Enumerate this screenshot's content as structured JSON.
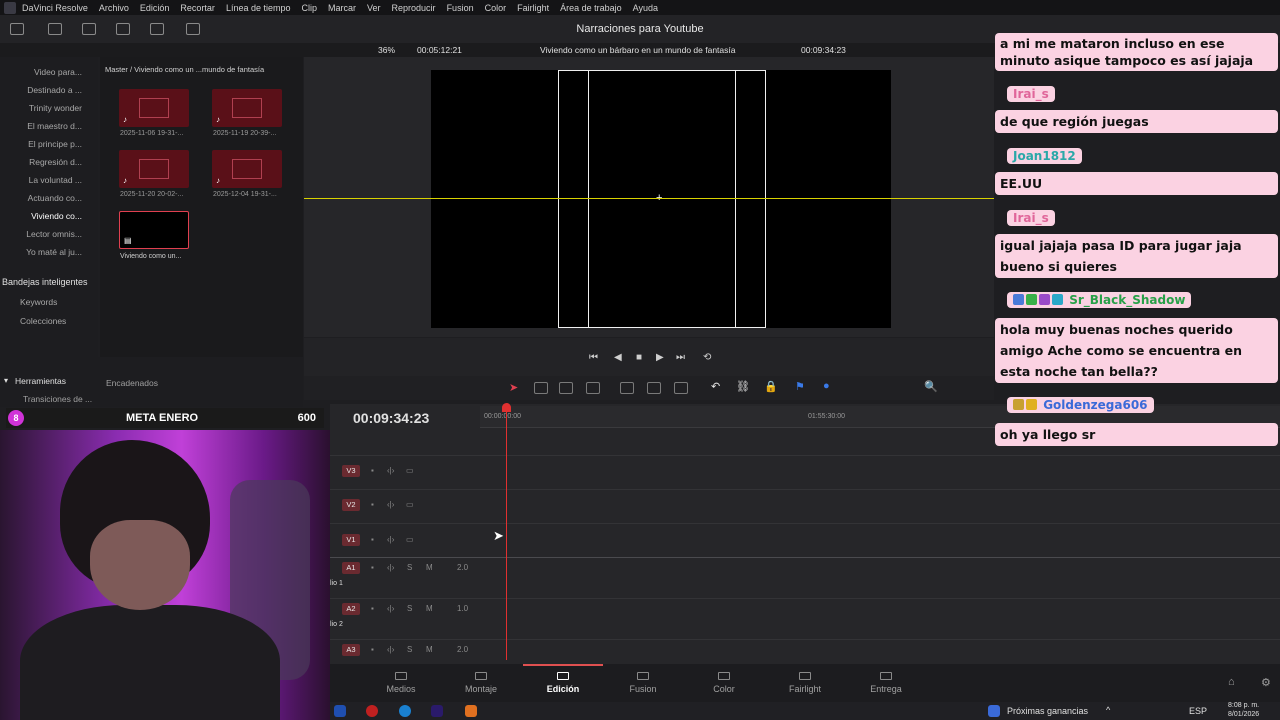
{
  "menubar": {
    "items": [
      "DaVinci Resolve",
      "Archivo",
      "Edición",
      "Recortar",
      "Línea de tiempo",
      "Clip",
      "Marcar",
      "Ver",
      "Reproducir",
      "Fusion",
      "Color",
      "Fairlight",
      "Área de trabajo",
      "Ayuda"
    ]
  },
  "titlebar": {
    "title": "Narraciones para Youtube"
  },
  "viewer_bar": {
    "zoom": "36%",
    "source_timecode": "00:05:12:21",
    "timeline_name": "Viviendo como un bárbaro en un mundo de fantasía",
    "record_timecode": "00:09:34:23"
  },
  "bins": {
    "items": [
      "Video para...",
      "Destinado a ...",
      "Trinity wonder",
      "El maestro d...",
      "El principe p...",
      "Regresión d...",
      "La voluntad ...",
      "Actuando co...",
      "Viviendo co...",
      "Lector omnis...",
      "Yo maté al ju..."
    ],
    "active_index": 8,
    "smart_bins_title": "Bandejas inteligentes",
    "smart_bins": [
      "Keywords",
      "Colecciones"
    ]
  },
  "media_pool": {
    "path": "Master / Viviendo como un ...mundo de fantasía",
    "clips": [
      {
        "name": "2025-11-06 19-31-..."
      },
      {
        "name": "2025-11-19 20-39-..."
      },
      {
        "name": "2025-11-20 20-02-..."
      },
      {
        "name": "2025-12-04 19-31-..."
      },
      {
        "name": "Viviendo como un..."
      }
    ]
  },
  "lower_left": {
    "tools_label": "Herramientas",
    "transitions": "Transiciones de ...",
    "transitions2": "Transiciones de ...",
    "chained_label": "Encadenados"
  },
  "timeline": {
    "timecode": "00:09:34:23",
    "ruler_start": "00:00:00:00",
    "ruler_mid": "01:55:30:00",
    "tracks": [
      {
        "label": "V3"
      },
      {
        "label": "V2"
      },
      {
        "label": "V1"
      },
      {
        "label": "A1",
        "level": "2.0",
        "name": "lio 1"
      },
      {
        "label": "A2",
        "level": "1.0",
        "name": "lio 2"
      },
      {
        "label": "A3",
        "level": "2.0"
      }
    ]
  },
  "stream_overlay": {
    "badge": "8",
    "goal_label": "META ENERO",
    "goal_count": "600"
  },
  "chat": [
    {
      "type": "msg",
      "text": "a mi me mataron incluso en ese minuto asique tampoco es así jajaja"
    },
    {
      "type": "user",
      "name": "Irai_s",
      "color": "pink"
    },
    {
      "type": "msg",
      "text": "de que región juegas"
    },
    {
      "type": "user",
      "name": "Joan1812",
      "color": "teal"
    },
    {
      "type": "msg",
      "text": "EE.UU"
    },
    {
      "type": "user",
      "name": "Irai_s",
      "color": "pink"
    },
    {
      "type": "msg",
      "text": "igual jajaja pasa ID para jugar jaja bueno si quieres"
    },
    {
      "type": "user",
      "name": "Sr_Black_Shadow",
      "color": "green"
    },
    {
      "type": "msg",
      "text": "hola muy buenas noches querido amigo Ache como se encuentra en esta noche tan bella??"
    },
    {
      "type": "user",
      "name": "Goldenzega606",
      "color": "blue"
    },
    {
      "type": "msg",
      "text": "oh ya llego sr"
    }
  ],
  "pages": [
    "Medios",
    "Montaje",
    "Edición",
    "Fusion",
    "Color",
    "Fairlight",
    "Entrega"
  ],
  "active_page": "Edición",
  "taskbar": {
    "widget": "Próximas ganancias",
    "lang": "ESP",
    "time": "8:08 p. m.",
    "date": "8/01/2026"
  }
}
